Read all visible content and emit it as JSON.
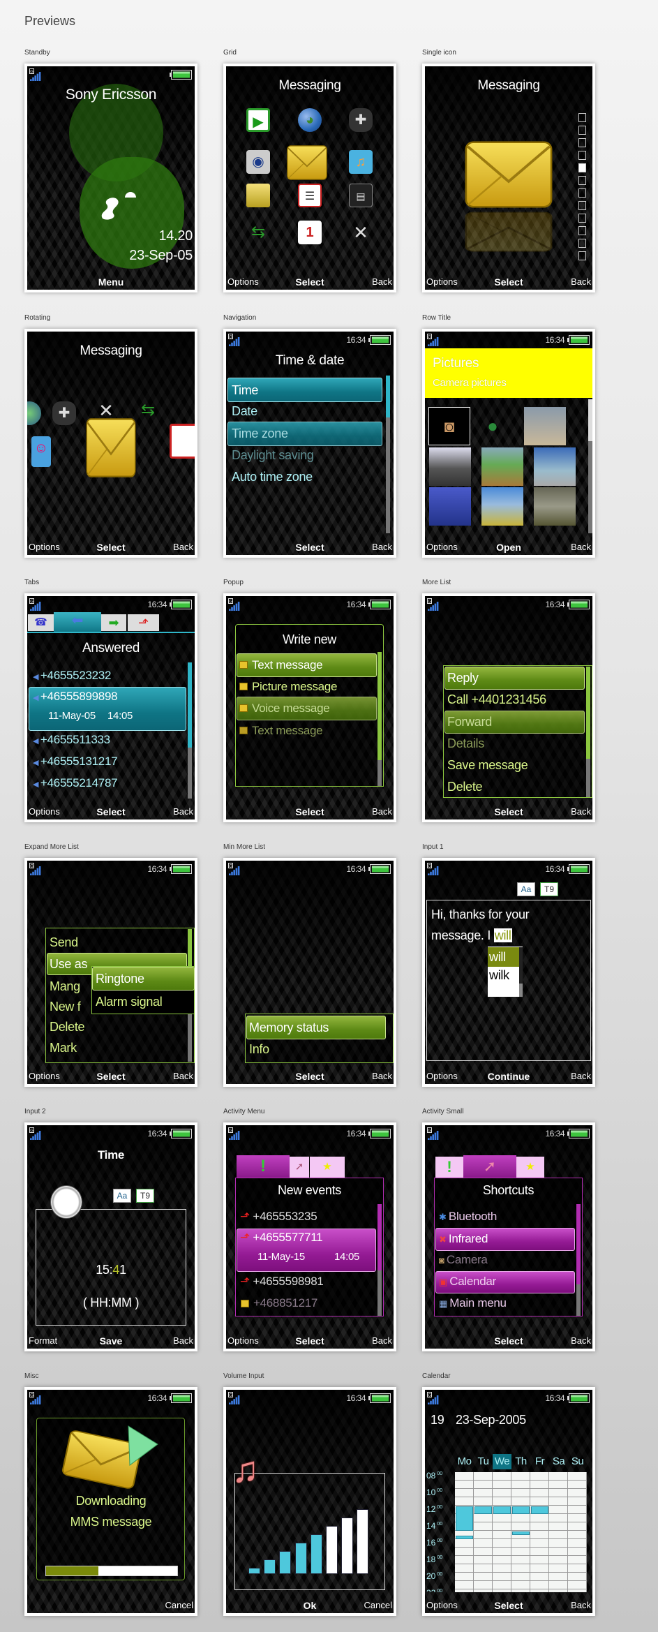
{
  "page": {
    "title": "Previews"
  },
  "status": {
    "time": "16:34"
  },
  "colors": {
    "green_highlight": "#6b9a1e",
    "teal_highlight": "#1a8c9c",
    "magenta_highlight": "#a52ca5",
    "row_title_band": "#ffff00",
    "list_text": "#d9f58a",
    "volume_active": "#4ec8dc",
    "progress_fill": "#7a8a0a"
  },
  "previews": {
    "standby": {
      "label": "Standby",
      "brand": "Sony Ericsson",
      "time": "14.20",
      "date": "23-Sep-05",
      "softkeys": {
        "center": "Menu"
      }
    },
    "grid": {
      "label": "Grid",
      "title": "Messaging",
      "icons": [
        "media-player",
        "internet-globe",
        "games",
        "camera",
        "messaging",
        "entertainment",
        "file-manager",
        "phonebook",
        "radio",
        "calls",
        "organizer",
        "settings"
      ],
      "selected_icon": "messaging",
      "softkeys": {
        "left": "Options",
        "center": "Select",
        "right": "Back"
      }
    },
    "single_icon": {
      "label": "Single icon",
      "title": "Messaging",
      "page_index": 5,
      "page_count": 12,
      "softkeys": {
        "left": "Options",
        "center": "Select",
        "right": "Back"
      }
    },
    "rotating": {
      "label": "Rotating",
      "title": "Messaging",
      "softkeys": {
        "left": "Options",
        "center": "Select",
        "right": "Back"
      }
    },
    "navigation": {
      "label": "Navigation",
      "title": "Time & date",
      "items": [
        {
          "label": "Time",
          "state": "selected"
        },
        {
          "label": "Date",
          "state": "normal"
        },
        {
          "label": "Time zone",
          "state": "highlighted-dim"
        },
        {
          "label": "Daylight saving",
          "state": "disabled"
        },
        {
          "label": "Auto time zone",
          "state": "normal"
        }
      ],
      "softkeys": {
        "center": "Select",
        "right": "Back"
      }
    },
    "row_title": {
      "label": "Row Title",
      "title": "Pictures",
      "subtitle": "Camera pictures",
      "softkeys": {
        "left": "Options",
        "center": "Open",
        "right": "Back"
      }
    },
    "tabs": {
      "label": "Tabs",
      "title": "Answered",
      "tab_icons": [
        "all-calls",
        "answered",
        "dialled",
        "missed"
      ],
      "active_tab": 1,
      "items": [
        "+4655523232",
        "+46555899898",
        "+4655511333",
        "+46555131217",
        "+46555214787"
      ],
      "selected": {
        "date": "11-May-05",
        "time": "14:05"
      },
      "softkeys": {
        "left": "Options",
        "center": "Select",
        "right": "Back"
      }
    },
    "popup": {
      "label": "Popup",
      "title": "Write new",
      "items": [
        "Text message",
        "Picture message",
        "Voice message",
        "Text message"
      ],
      "softkeys": {
        "center": "Select",
        "right": "Back"
      }
    },
    "more_list": {
      "label": "More List",
      "items": [
        "Reply",
        "Call +4401231456",
        "Forward",
        "Details",
        "Save message",
        "Delete"
      ],
      "softkeys": {
        "center": "Select",
        "right": "Back"
      }
    },
    "expand_more_list": {
      "label": "Expand More List",
      "items": [
        "Send",
        "Use as",
        "Mang",
        "New f",
        "Delete",
        "Mark"
      ],
      "submenu": [
        "Ringtone",
        "Alarm signal"
      ],
      "softkeys": {
        "left": "Options",
        "center": "Select",
        "right": "Back"
      }
    },
    "min_more_list": {
      "label": "Min More List",
      "items": [
        "Memory status",
        "Info"
      ],
      "softkeys": {
        "center": "Select",
        "right": "Back"
      }
    },
    "input_1": {
      "label": "Input 1",
      "mode_case": "Aa",
      "mode_t9": "T9",
      "line1": "Hi, thanks for your",
      "line2": "message. I",
      "current_word": "will",
      "suggestions": [
        "will",
        "wilk"
      ],
      "softkeys": {
        "left": "Options",
        "center": "Continue",
        "right": "Back"
      }
    },
    "input_2": {
      "label": "Input 2",
      "title": "Time",
      "mode_case": "Aa",
      "mode_t9": "T9",
      "value_before": "15:",
      "value_cursor": "4",
      "value_after": "1",
      "format": "( HH:MM )",
      "softkeys": {
        "left": "Format",
        "center": "Save",
        "right": "Back"
      }
    },
    "activity_menu": {
      "label": "Activity Menu",
      "title": "New events",
      "items": [
        "+465553235",
        "+4655577711",
        "+4655598981",
        "+468851217"
      ],
      "selected": {
        "date": "11-May-15",
        "time": "14:05"
      },
      "softkeys": {
        "left": "Options",
        "center": "Select",
        "right": "Back"
      }
    },
    "activity_small": {
      "label": "Activity Small",
      "title": "Shortcuts",
      "items": [
        "Bluetooth",
        "Infrared",
        "Camera",
        "Calendar",
        "Main menu"
      ],
      "softkeys": {
        "center": "Select",
        "right": "Back"
      }
    },
    "misc": {
      "label": "Misc",
      "line1": "Downloading",
      "line2": "MMS message",
      "progress": 0.4,
      "softkeys": {
        "right": "Cancel"
      }
    },
    "volume_input": {
      "label": "Volume Input",
      "level": 5,
      "max_level": 8,
      "softkeys": {
        "center": "Ok",
        "right": "Cancel"
      }
    },
    "calendar": {
      "label": "Calendar",
      "week": "19",
      "date": "23-Sep-2005",
      "days": [
        "Mo",
        "Tu",
        "We",
        "Th",
        "Fr",
        "Sa",
        "Su"
      ],
      "selected_day": "We",
      "hours": [
        "08",
        "10",
        "12",
        "14",
        "16",
        "18",
        "20",
        "22"
      ],
      "minutes": "00",
      "events": [
        {
          "day": "Mo",
          "start": 12,
          "end": 15
        },
        {
          "day": "Mo",
          "start": 15.5,
          "end": 16
        },
        {
          "day": "Tu",
          "start": 12,
          "end": 13
        },
        {
          "day": "We",
          "start": 12,
          "end": 13
        },
        {
          "day": "Th",
          "start": 12,
          "end": 13
        },
        {
          "day": "Fr",
          "start": 12,
          "end": 13
        },
        {
          "day": "Th",
          "start": 15,
          "end": 15.5
        }
      ],
      "softkeys": {
        "left": "Options",
        "center": "Select",
        "right": "Back"
      }
    }
  }
}
